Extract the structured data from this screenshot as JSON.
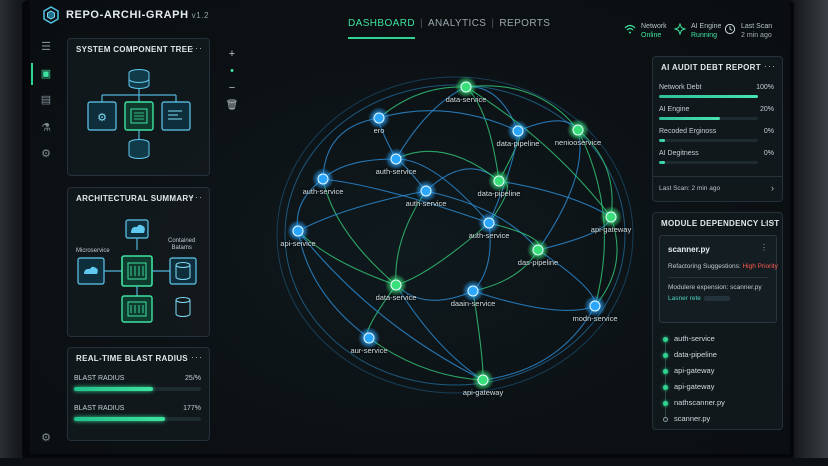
{
  "app": {
    "title": "REPO-ARCHI-GRAPH",
    "version": "v1.2"
  },
  "nav": {
    "tabs": [
      "DASHBOARD",
      "ANALYTICS",
      "REPORTS"
    ],
    "active": 0
  },
  "status": {
    "network": {
      "label": "Network",
      "value": "Online"
    },
    "ai_engine": {
      "label": "AI Engine",
      "value": "Running"
    },
    "last_scan": {
      "label": "Last Scan",
      "value": "2 min ago"
    }
  },
  "panels": {
    "component_tree": {
      "title": "SYSTEM COMPONENT TREE"
    },
    "arch_summary": {
      "title": "ARCHITECTURAL SUMMARY",
      "label_left": "Microservice",
      "label_right_1": "Contained",
      "label_right_2": "Batams"
    },
    "blast": {
      "title": "REAL-TIME BLAST RADIUS",
      "rows": [
        {
          "label": "BLAST RADIUS",
          "pct": "25/%",
          "level": 0.62
        },
        {
          "label": "BLAST RADIUS",
          "pct": "177%",
          "level": 0.72
        }
      ]
    },
    "audit": {
      "title": "AI AUDIT DEBT REPORT",
      "rows": [
        {
          "label": "Network Debt",
          "pct": "100%",
          "level": 1.0
        },
        {
          "label": "AI Engine",
          "pct": "20%",
          "level": 0.62
        },
        {
          "label": "Recoded Erginoss",
          "pct": "0%",
          "level": 0.06
        },
        {
          "label": "AI Degitness",
          "pct": "0%",
          "level": 0.06
        }
      ],
      "footer": "Last Scan: 2 min ago"
    },
    "modules": {
      "title": "MODULE DEPENDENCY LIST",
      "card": {
        "file": "scanner.py",
        "suggest_label": "Refactoring Suggestions:",
        "suggest_value": "High Priority",
        "exp_label": "Modulere expension:",
        "exp_value": "scanner.py",
        "link": "Lasner rete"
      },
      "items": [
        "auth-service",
        "data-pipeline",
        "api-gateway",
        "api-gateway",
        "nathscanner.py",
        "scanner.py"
      ]
    }
  },
  "graph": {
    "nodes": [
      {
        "id": "n1",
        "label": "data-service",
        "color": "green"
      },
      {
        "id": "n2",
        "label": "ero",
        "color": "blue"
      },
      {
        "id": "n3",
        "label": "data-pipeline",
        "color": "blue"
      },
      {
        "id": "n4",
        "label": "neniooservice",
        "color": "green"
      },
      {
        "id": "n5",
        "label": "auth-service",
        "color": "blue"
      },
      {
        "id": "n6",
        "label": "auth-service",
        "color": "blue"
      },
      {
        "id": "n7",
        "label": "auth-service",
        "color": "blue"
      },
      {
        "id": "n8",
        "label": "data-pipeline",
        "color": "green"
      },
      {
        "id": "n9",
        "label": "api-gateway",
        "color": "green"
      },
      {
        "id": "n10",
        "label": "api-seivice",
        "color": "blue"
      },
      {
        "id": "n11",
        "label": "auth-service",
        "color": "blue"
      },
      {
        "id": "n12",
        "label": "das-pipeline",
        "color": "green"
      },
      {
        "id": "n13",
        "label": "data-service",
        "color": "green"
      },
      {
        "id": "n14",
        "label": "daain-service",
        "color": "blue"
      },
      {
        "id": "n15",
        "label": "modn-service",
        "color": "blue"
      },
      {
        "id": "n16",
        "label": "aur-service",
        "color": "blue"
      },
      {
        "id": "n17",
        "label": "api-gateway",
        "color": "green"
      }
    ]
  },
  "colors": {
    "accent": "#3fe3a0",
    "node_blue": "#2aa6ff",
    "node_green": "#39e07a",
    "danger": "#ff5a52"
  }
}
